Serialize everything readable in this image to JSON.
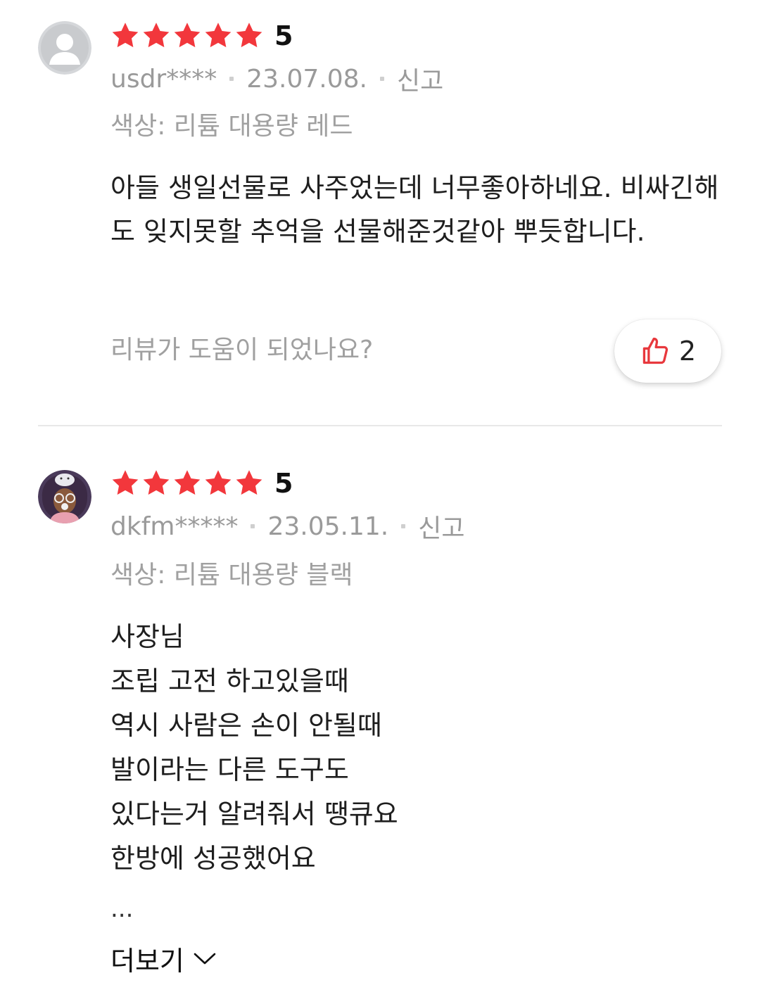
{
  "reviews": [
    {
      "rating": "5",
      "stars": 5,
      "user": "usdr****",
      "date": "23.07.08.",
      "report": "신고",
      "option": "색상: 리튬 대용량 레드",
      "body": "아들 생일선물로 사주었는데 너무좋아하네요. 비싸긴해도 잊지못할 추억을 선물해준것같아 뿌듯합니다.",
      "helpful_question": "리뷰가 도움이 되었나요?",
      "like_count": "2",
      "avatar": "default-user-avatar"
    },
    {
      "rating": "5",
      "stars": 5,
      "user": "dkfm*****",
      "date": "23.05.11.",
      "report": "신고",
      "option": "색상: 리튬 대용량 블랙",
      "body": "사장님\n조립 고전 하고있을때\n역시 사람은 손이 안될때\n발이라는 다른 도구도\n있다는거 알려줘서 땡큐요\n한방에 성공했어요",
      "ellipsis": "...",
      "more_label": "더보기",
      "avatar": "character-avatar"
    }
  ],
  "colors": {
    "star": "#f2373c",
    "like_icon": "#e8383d",
    "meta": "#9a9a9a",
    "divider": "#e8e8e8"
  }
}
